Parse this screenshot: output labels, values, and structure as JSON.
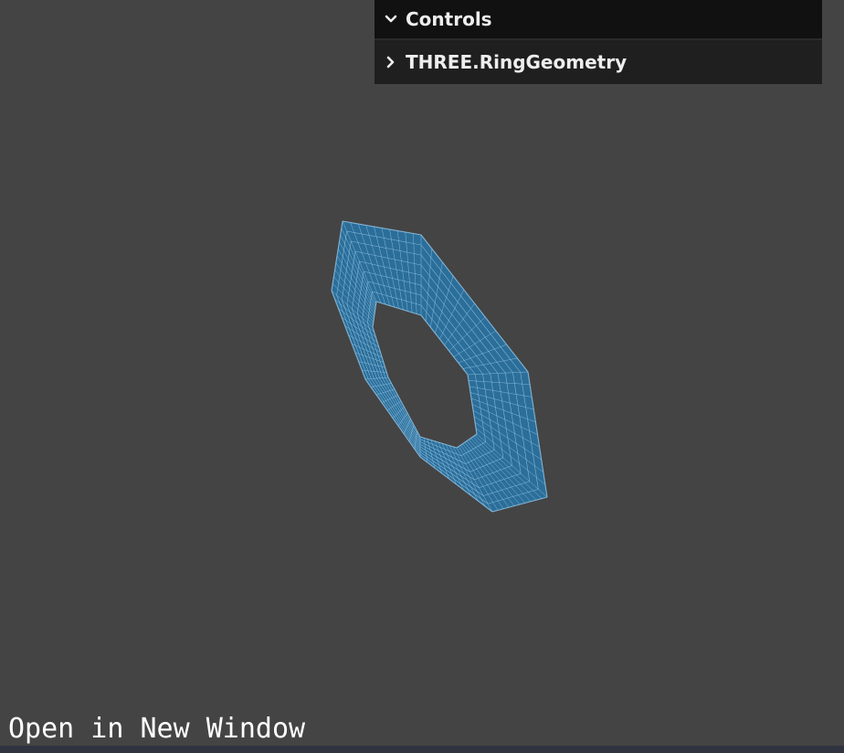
{
  "controls_panel": {
    "title": "Controls",
    "folders": [
      {
        "label": "THREE.RingGeometry",
        "expanded": false
      }
    ],
    "expanded": true
  },
  "scene": {
    "object": "ring-geometry-wireframe",
    "mesh_color": "#2b6e99",
    "wire_color": "#8fc3e6",
    "background": "#444444"
  },
  "footer": {
    "open_new_window_label": "Open in New Window"
  },
  "icons": {
    "controls_toggle": "chevron-down-icon",
    "folder_toggle": "chevron-right-icon"
  }
}
